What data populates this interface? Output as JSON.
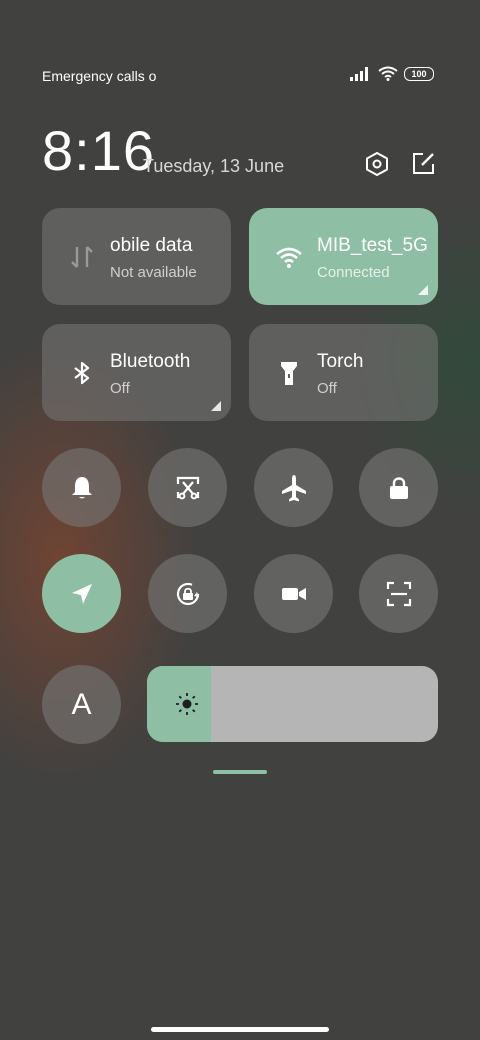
{
  "status_bar": {
    "carrier_text": "Emergency calls o",
    "battery_level": "100",
    "icons": [
      "signal-icon",
      "wifi-icon",
      "battery-icon"
    ]
  },
  "header": {
    "time": "8:16",
    "date": "Tuesday, 13 June",
    "icons": [
      "settings-icon",
      "edit-icon"
    ]
  },
  "tiles": [
    {
      "title": "obile data",
      "subtitle": "Not available",
      "icon": "mobile-data-icon",
      "active": false
    },
    {
      "title": "MIB_test_5G",
      "subtitle": "Connected",
      "icon": "wifi-icon",
      "active": true
    },
    {
      "title": "Bluetooth",
      "subtitle": "Off",
      "icon": "bluetooth-icon",
      "active": false
    },
    {
      "title": "Torch",
      "subtitle": "Off",
      "icon": "torch-icon",
      "active": false
    }
  ],
  "toggles": [
    {
      "icon": "bell-icon",
      "active": false
    },
    {
      "icon": "screenshot-icon",
      "active": false
    },
    {
      "icon": "airplane-icon",
      "active": false
    },
    {
      "icon": "lock-icon",
      "active": false
    },
    {
      "icon": "location-icon",
      "active": true
    },
    {
      "icon": "rotation-lock-icon",
      "active": false
    },
    {
      "icon": "video-camera-icon",
      "active": false
    },
    {
      "icon": "scanner-icon",
      "active": false
    }
  ],
  "auto_brightness": {
    "label": "A",
    "icon": "auto-brightness-icon"
  },
  "brightness": {
    "level_percent": 22,
    "icon": "sun-icon"
  },
  "colors": {
    "accent": "#8ebfa4",
    "tile_inactive": "#6e6e6c",
    "background": "#414140"
  }
}
